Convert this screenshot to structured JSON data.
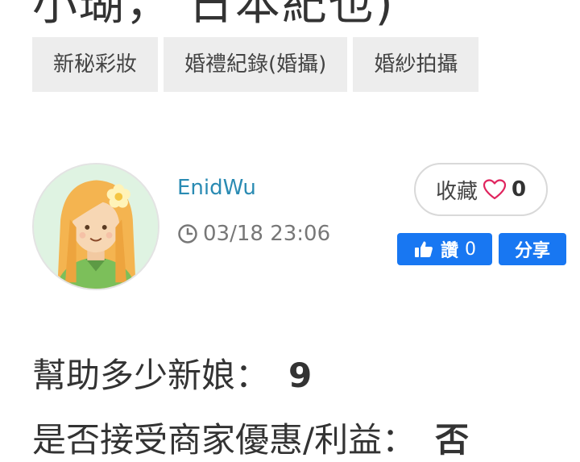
{
  "post": {
    "title_fragment": "小瑚， 日本紀也)"
  },
  "tags": [
    "新秘彩妝",
    "婚禮紀錄(婚攝)",
    "婚紗拍攝"
  ],
  "author": {
    "name": "EnidWu",
    "avatar_icon": "girl-avatar-icon"
  },
  "timestamp": "03/18 23:06",
  "favorite": {
    "label": "收藏",
    "count": "0",
    "icon": "heart-outline-icon"
  },
  "facebook": {
    "like_label": "讚",
    "like_count": "0",
    "share_label": "分享",
    "color": "#1877f2"
  },
  "stats": [
    {
      "label": "幫助多少新娘：",
      "value": "9"
    },
    {
      "label": "是否接受商家優惠/利益：",
      "value": "否"
    }
  ],
  "colors": {
    "author_link": "#2a8bb3",
    "tag_bg": "#ededed",
    "heart": "#e0245e"
  }
}
